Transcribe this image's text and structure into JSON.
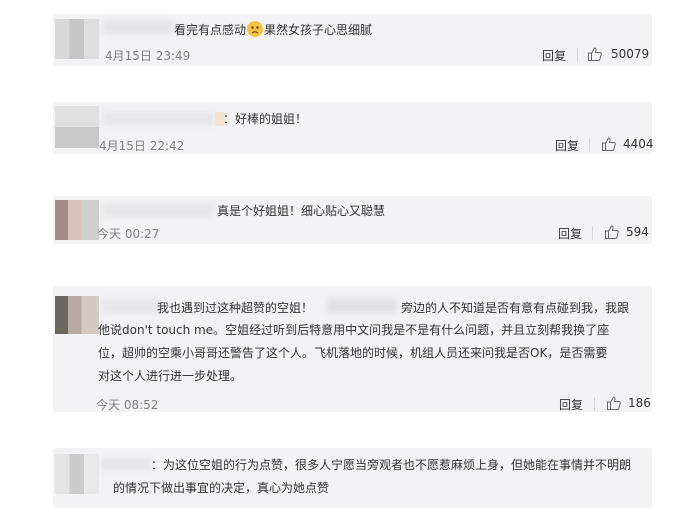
{
  "comments": [
    {
      "text_a": "看完有点感动",
      "emoji": "sad-face-emoji",
      "text_b": "果然女孩子心思细腻",
      "time": "4月15日 23:49",
      "reply": "回复",
      "likes": "50079"
    },
    {
      "text": "：好棒的姐姐！",
      "time": "4月15日 22:42",
      "reply": "回复",
      "likes": "4404"
    },
    {
      "text": "真是个好姐姐！细心贴心又聪慧",
      "time": "今天 00:27",
      "reply": "回复",
      "likes": "594"
    },
    {
      "text_a": "我也遇到过这种超赞的空姐！",
      "text_b": "旁边的人不知道是否有意有点碰到我，我跟",
      "line2": "他说don't touch me。空姐经过听到后特意用中文问我是不是有什么问题，并且立刻帮我换了座",
      "line3": "位，超帅的空乘小哥哥还警告了这个人。飞机落地的时候，机组人员还来问我是否OK，是否需要",
      "line4": "对这个人进行进一步处理。",
      "time": "今天 08:52",
      "reply": "回复",
      "likes": "186"
    },
    {
      "line1": "：为这位空姐的行为点赞，很多人宁愿当旁观者也不愿惹麻烦上身，但她能在事情并不明朗",
      "line2": "的情况下做出事宜的决定，真心为她点赞"
    }
  ],
  "colors": {
    "card_bg": "#f2f2f5",
    "time": "#808080",
    "text": "#333333"
  }
}
